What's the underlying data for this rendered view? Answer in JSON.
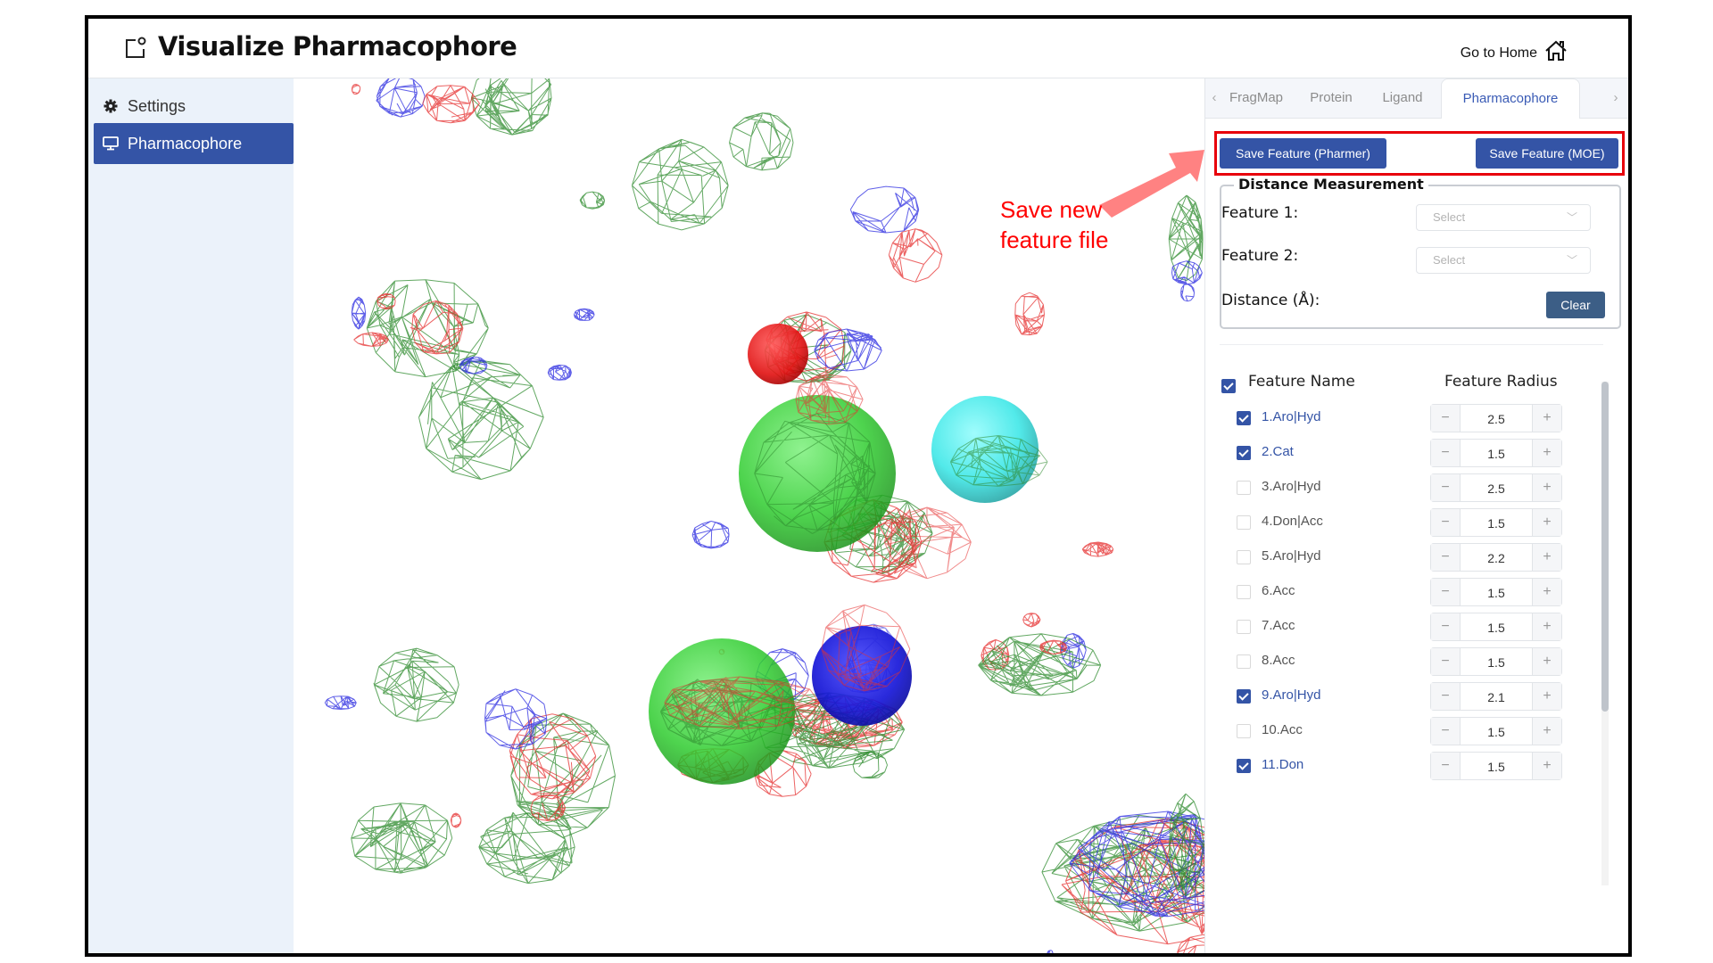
{
  "header": {
    "title": "Visualize Pharmacophore",
    "home_link": "Go to Home",
    "app_icon": "window-badge-icon",
    "home_icon": "home-icon"
  },
  "sidebar": {
    "items": [
      {
        "label": "Settings",
        "icon": "gear-icon",
        "active": false
      },
      {
        "label": "Pharmacophore",
        "icon": "monitor-icon",
        "active": true
      }
    ]
  },
  "tabs": {
    "items": [
      {
        "label": "FragMap",
        "active": false
      },
      {
        "label": "Protein",
        "active": false
      },
      {
        "label": "Ligand",
        "active": false
      },
      {
        "label": "Pharmacophore",
        "active": true
      }
    ],
    "prev_icon": "chevron-left-icon",
    "next_icon": "chevron-right-icon"
  },
  "actions": {
    "save_pharmer": "Save Feature (Pharmer)",
    "save_moe": "Save Feature (MOE)"
  },
  "distance": {
    "legend": "Distance Measurement",
    "feature1_label": "Feature 1:",
    "feature2_label": "Feature 2:",
    "feature1_value": "Select",
    "feature2_value": "Select",
    "distance_label": "Distance (Å):",
    "clear": "Clear"
  },
  "features": {
    "header_name": "Feature Name",
    "header_radius": "Feature Radius",
    "all_checked": true,
    "rows": [
      {
        "name": "1.Aro|Hyd",
        "checked": true,
        "radius": "2.5"
      },
      {
        "name": "2.Cat",
        "checked": true,
        "radius": "1.5"
      },
      {
        "name": "3.Aro|Hyd",
        "checked": false,
        "radius": "2.5"
      },
      {
        "name": "4.Don|Acc",
        "checked": false,
        "radius": "1.5"
      },
      {
        "name": "5.Aro|Hyd",
        "checked": false,
        "radius": "2.2"
      },
      {
        "name": "6.Acc",
        "checked": false,
        "radius": "1.5"
      },
      {
        "name": "7.Acc",
        "checked": false,
        "radius": "1.5"
      },
      {
        "name": "8.Acc",
        "checked": false,
        "radius": "1.5"
      },
      {
        "name": "9.Aro|Hyd",
        "checked": true,
        "radius": "2.1"
      },
      {
        "name": "10.Acc",
        "checked": false,
        "radius": "1.5"
      },
      {
        "name": "11.Don",
        "checked": true,
        "radius": "1.5"
      }
    ],
    "minus_symbol": "−",
    "plus_symbol": "+"
  },
  "annotation": {
    "line1": "Save new",
    "line2": "feature file",
    "color": "#ff0000"
  },
  "viewer": {
    "spheres": [
      {
        "feature": "1.Aro|Hyd",
        "color": "#22cc22"
      },
      {
        "feature": "2.Cat",
        "color": "#33eeee"
      },
      {
        "feature": "9.Aro|Hyd",
        "color": "#22cc22"
      },
      {
        "feature": "11.Don",
        "color": "#1111dd"
      },
      {
        "feature": "acceptor",
        "color": "#ee1111"
      }
    ],
    "mesh_colors": {
      "hydrophobic": "#2e8b2e",
      "acceptor": "#e53030",
      "donor": "#2a2ae0"
    }
  },
  "colors": {
    "accent": "#3454a6",
    "clear_button": "#3c5e86",
    "sidebar_bg": "#ebf2fa",
    "highlight_box": "#e8000b"
  }
}
